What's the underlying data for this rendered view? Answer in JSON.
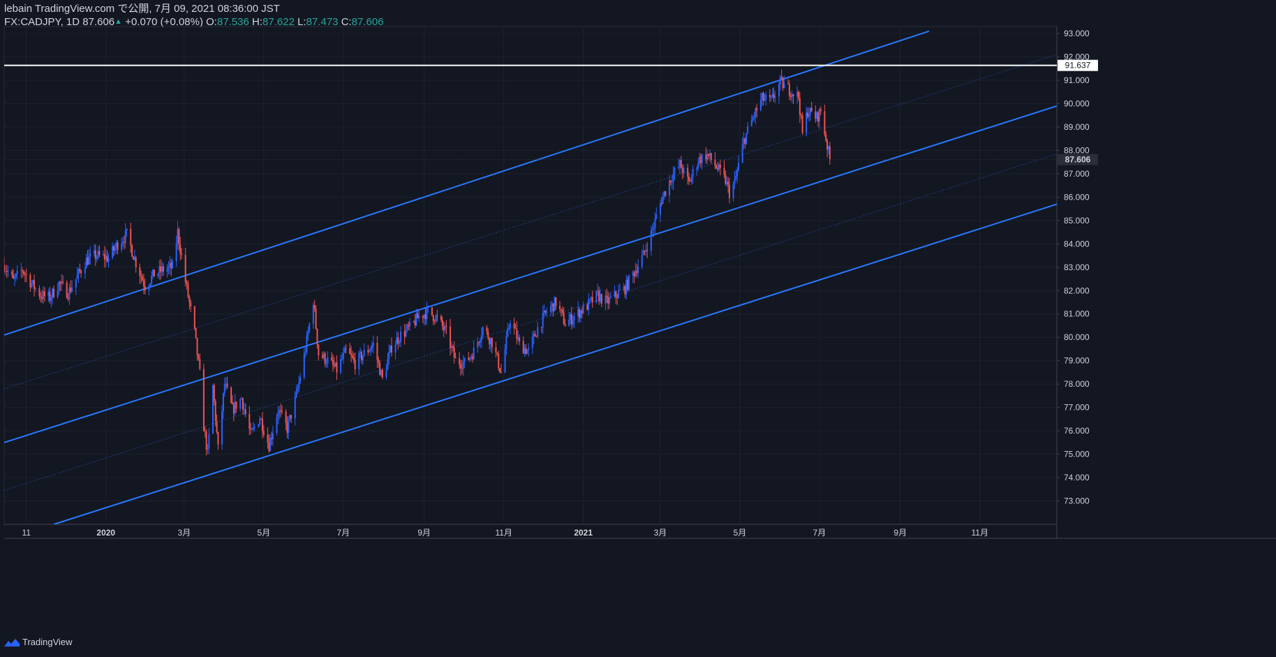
{
  "header": {
    "line1": "lebain TradingView.com で公開, 7月 09, 2021 08:36:00 JST",
    "symbol": "FX:CADJPY, 1D",
    "last": "87.606",
    "change": "+0.070 (+0.08%)",
    "o_label": "O:",
    "o_value": "87.536",
    "h_label": "H:",
    "h_value": "87.622",
    "l_label": "L:",
    "l_value": "87.473",
    "c_label": "C:",
    "c_value": "87.606"
  },
  "footer": {
    "brand": "TradingView",
    "logo_icon": "tradingview-logo-icon"
  },
  "colors": {
    "bg": "#131722",
    "up": "#2962ff",
    "down": "#ef5350",
    "channel": "#2979ff",
    "grid": "#1e222d",
    "text": "#d1d4dc"
  },
  "chart_data": {
    "type": "candlestick",
    "title": "",
    "xlabel": "",
    "ylabel": "",
    "ylim": [
      72.0,
      93.3
    ],
    "y_ticks": [
      "93.000",
      "92.000",
      "91.000",
      "90.000",
      "89.000",
      "88.000",
      "87.000",
      "86.000",
      "85.000",
      "84.000",
      "83.000",
      "82.000",
      "81.000",
      "80.000",
      "79.000",
      "78.000",
      "77.000",
      "76.000",
      "75.000",
      "74.000",
      "73.000"
    ],
    "x_ticks": [
      {
        "label": "11",
        "date": "2019-11-01"
      },
      {
        "label": "2020",
        "date": "2020-01-01"
      },
      {
        "label": "3月",
        "date": "2020-03-01"
      },
      {
        "label": "5月",
        "date": "2020-05-01"
      },
      {
        "label": "7月",
        "date": "2020-07-01"
      },
      {
        "label": "9月",
        "date": "2020-09-01"
      },
      {
        "label": "11月",
        "date": "2020-11-01"
      },
      {
        "label": "2021",
        "date": "2021-01-01"
      },
      {
        "label": "3月",
        "date": "2021-03-01"
      },
      {
        "label": "5月",
        "date": "2021-05-01"
      },
      {
        "label": "7月",
        "date": "2021-07-01"
      },
      {
        "label": "9月",
        "date": "2021-09-01"
      },
      {
        "label": "11月",
        "date": "2021-11-01"
      }
    ],
    "date_range": [
      "2019-10-15",
      "2021-12-30"
    ],
    "price_path": [
      [
        "2019-10-15",
        83.1
      ],
      [
        "2019-10-22",
        82.4
      ],
      [
        "2019-10-29",
        82.9
      ],
      [
        "2019-11-05",
        82.3
      ],
      [
        "2019-11-12",
        81.8
      ],
      [
        "2019-11-19",
        81.7
      ],
      [
        "2019-11-26",
        82.3
      ],
      [
        "2019-12-03",
        81.9
      ],
      [
        "2019-12-10",
        82.6
      ],
      [
        "2019-12-17",
        83.3
      ],
      [
        "2019-12-24",
        83.5
      ],
      [
        "2020-01-03",
        83.4
      ],
      [
        "2020-01-10",
        84.0
      ],
      [
        "2020-01-17",
        84.4
      ],
      [
        "2020-01-24",
        83.2
      ],
      [
        "2020-01-31",
        82.2
      ],
      [
        "2020-02-07",
        82.7
      ],
      [
        "2020-02-14",
        82.9
      ],
      [
        "2020-02-21",
        83.0
      ],
      [
        "2020-02-25",
        84.5
      ],
      [
        "2020-03-02",
        82.4
      ],
      [
        "2020-03-09",
        80.2
      ],
      [
        "2020-03-13",
        78.4
      ],
      [
        "2020-03-16",
        76.2
      ],
      [
        "2020-03-19",
        75.0
      ],
      [
        "2020-03-23",
        77.9
      ],
      [
        "2020-03-27",
        75.2
      ],
      [
        "2020-04-01",
        78.0
      ],
      [
        "2020-04-07",
        76.9
      ],
      [
        "2020-04-14",
        77.4
      ],
      [
        "2020-04-21",
        75.8
      ],
      [
        "2020-04-28",
        76.6
      ],
      [
        "2020-05-05",
        75.4
      ],
      [
        "2020-05-12",
        76.9
      ],
      [
        "2020-05-19",
        76.1
      ],
      [
        "2020-05-26",
        77.5
      ],
      [
        "2020-06-02",
        79.5
      ],
      [
        "2020-06-08",
        81.6
      ],
      [
        "2020-06-12",
        79.3
      ],
      [
        "2020-06-19",
        79.0
      ],
      [
        "2020-06-26",
        78.6
      ],
      [
        "2020-07-03",
        79.4
      ],
      [
        "2020-07-10",
        78.9
      ],
      [
        "2020-07-17",
        79.3
      ],
      [
        "2020-07-24",
        79.7
      ],
      [
        "2020-07-31",
        78.2
      ],
      [
        "2020-08-07",
        79.6
      ],
      [
        "2020-08-14",
        80.1
      ],
      [
        "2020-08-21",
        80.4
      ],
      [
        "2020-08-28",
        80.9
      ],
      [
        "2020-09-04",
        81.1
      ],
      [
        "2020-09-11",
        80.8
      ],
      [
        "2020-09-18",
        80.2
      ],
      [
        "2020-09-25",
        79.0
      ],
      [
        "2020-10-02",
        78.9
      ],
      [
        "2020-10-09",
        79.4
      ],
      [
        "2020-10-16",
        80.4
      ],
      [
        "2020-10-23",
        79.8
      ],
      [
        "2020-10-30",
        78.5
      ],
      [
        "2020-11-06",
        80.8
      ],
      [
        "2020-11-13",
        79.7
      ],
      [
        "2020-11-20",
        79.4
      ],
      [
        "2020-11-27",
        80.4
      ],
      [
        "2020-12-04",
        81.1
      ],
      [
        "2020-12-11",
        81.5
      ],
      [
        "2020-12-18",
        80.6
      ],
      [
        "2020-12-25",
        80.9
      ],
      [
        "2021-01-05",
        81.4
      ],
      [
        "2021-01-12",
        81.8
      ],
      [
        "2021-01-19",
        81.5
      ],
      [
        "2021-01-26",
        81.8
      ],
      [
        "2021-02-02",
        82.1
      ],
      [
        "2021-02-09",
        82.8
      ],
      [
        "2021-02-16",
        83.5
      ],
      [
        "2021-02-23",
        84.6
      ],
      [
        "2021-03-02",
        85.9
      ],
      [
        "2021-03-09",
        86.8
      ],
      [
        "2021-03-16",
        87.4
      ],
      [
        "2021-03-23",
        86.6
      ],
      [
        "2021-03-30",
        87.6
      ],
      [
        "2021-04-06",
        87.8
      ],
      [
        "2021-04-13",
        87.3
      ],
      [
        "2021-04-20",
        86.7
      ],
      [
        "2021-04-23",
        86.2
      ],
      [
        "2021-04-27",
        86.6
      ],
      [
        "2021-05-04",
        88.4
      ],
      [
        "2021-05-11",
        89.4
      ],
      [
        "2021-05-18",
        90.2
      ],
      [
        "2021-05-25",
        90.1
      ],
      [
        "2021-06-01",
        90.9
      ],
      [
        "2021-06-08",
        90.6
      ],
      [
        "2021-06-15",
        90.3
      ],
      [
        "2021-06-18",
        88.7
      ],
      [
        "2021-06-22",
        89.7
      ],
      [
        "2021-06-29",
        89.4
      ],
      [
        "2021-07-02",
        89.7
      ],
      [
        "2021-07-06",
        88.5
      ],
      [
        "2021-07-09",
        87.61
      ]
    ],
    "channels": [
      {
        "name": "",
        "style": "solid",
        "p1": [
          "2019-10-15",
          80.1
        ],
        "p2": [
          "2021-09-23",
          93.1
        ]
      },
      {
        "name": "",
        "style": "dotted",
        "p1": [
          "2019-10-15",
          77.8
        ],
        "p2": [
          "2021-12-30",
          92.1
        ]
      },
      {
        "name": "",
        "style": "solid",
        "p1": [
          "2019-10-15",
          75.5
        ],
        "p2": [
          "2021-12-30",
          89.9
        ]
      },
      {
        "name": "",
        "style": "dotted",
        "p1": [
          "2019-10-15",
          73.45
        ],
        "p2": [
          "2021-12-30",
          87.85
        ]
      },
      {
        "name": "",
        "style": "solid",
        "p1": [
          "2019-11-22",
          72.0
        ],
        "p2": [
          "2021-12-30",
          85.7
        ]
      }
    ],
    "horizontal_line": {
      "value": 91.637,
      "label": "91.637"
    },
    "last_price": {
      "value": 87.606,
      "label": "87.606"
    },
    "grid": true,
    "legend": "none"
  }
}
